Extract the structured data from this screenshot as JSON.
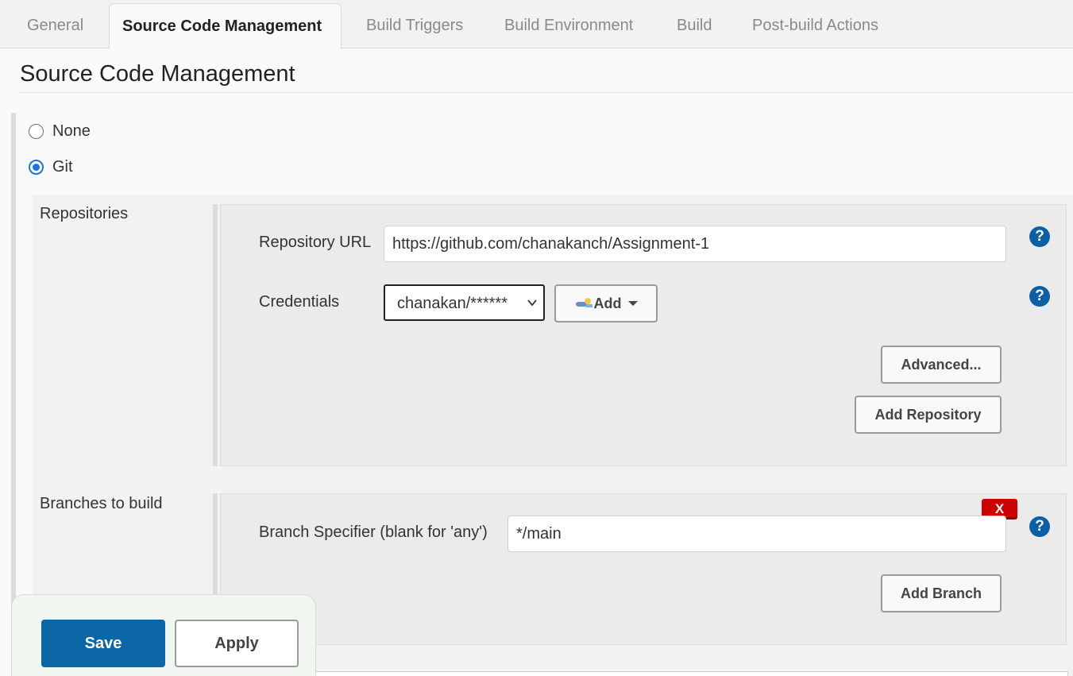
{
  "tabs": [
    {
      "label": "General",
      "active": false
    },
    {
      "label": "Source Code Management",
      "active": true
    },
    {
      "label": "Build Triggers",
      "active": false
    },
    {
      "label": "Build Environment",
      "active": false
    },
    {
      "label": "Build",
      "active": false
    },
    {
      "label": "Post-build Actions",
      "active": false
    }
  ],
  "section": {
    "title": "Source Code Management"
  },
  "scm_options": {
    "none_label": "None",
    "git_label": "Git",
    "selected": "Git"
  },
  "repositories": {
    "label": "Repositories",
    "url_label": "Repository URL",
    "url_value": "https://github.com/chanakanch/Assignment-1",
    "credentials_label": "Credentials",
    "credentials_value": "chanakan/******",
    "add_label": "Add",
    "advanced_label": "Advanced...",
    "add_repository_label": "Add Repository",
    "help_symbol": "?"
  },
  "branches": {
    "label": "Branches to build",
    "specifier_label": "Branch Specifier (blank for 'any')",
    "specifier_value": "*/main",
    "delete_label": "X",
    "add_branch_label": "Add Branch",
    "help_symbol": "?"
  },
  "actions": {
    "save_label": "Save",
    "apply_label": "Apply"
  },
  "colors": {
    "primary": "#0b66a6",
    "help": "#0b5fa5",
    "danger": "#cc0000"
  }
}
